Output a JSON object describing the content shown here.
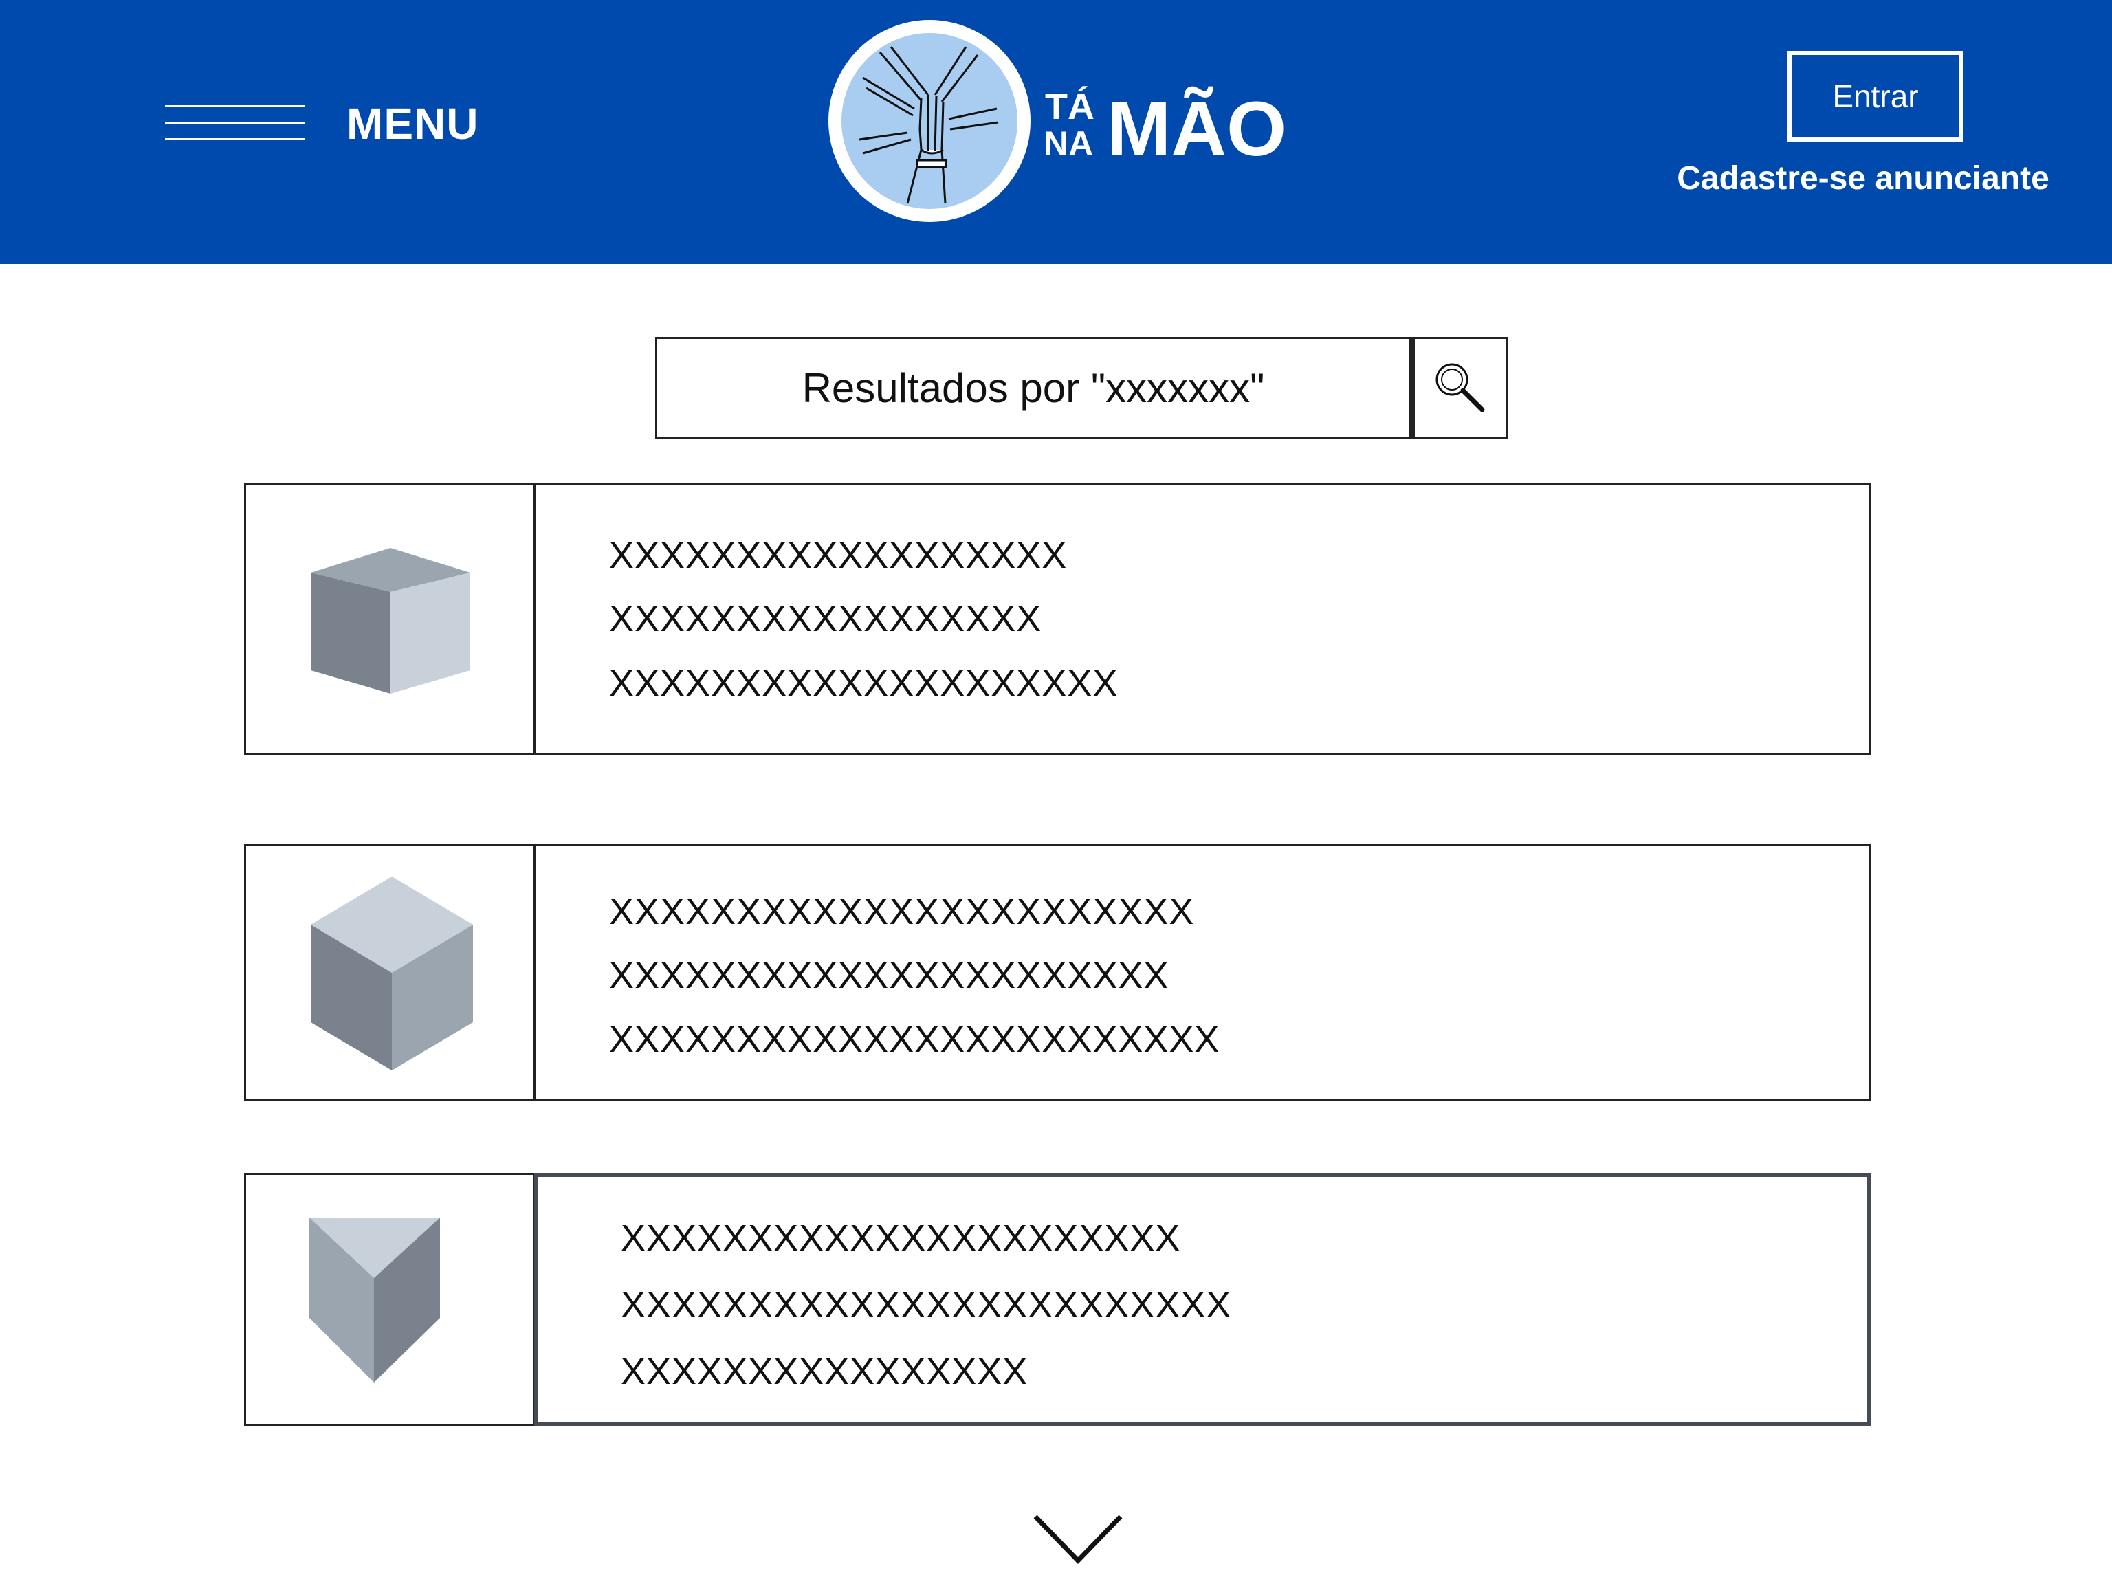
{
  "header": {
    "menu_label": "MENU",
    "logo_text": {
      "ta": "TÁ",
      "na": "NA",
      "mao": "MÃO"
    },
    "login_label": "Entrar",
    "register_label": "Cadastre-se anunciante"
  },
  "search": {
    "text": "Resultados por \"xxxxxxx\"",
    "icon": "magnifier-icon"
  },
  "results": [
    {
      "icon": "cube-icon",
      "lines": [
        "XXXXXXXXXXXXXXXXXX",
        "XXXXXXXXXXXXXXXXX",
        "XXXXXXXXXXXXXXXXXXXX"
      ]
    },
    {
      "icon": "cube-icon",
      "lines": [
        "XXXXXXXXXXXXXXXXXXXXXXX",
        "XXXXXXXXXXXXXXXXXXXXXX",
        "XXXXXXXXXXXXXXXXXXXXXXXX"
      ]
    },
    {
      "icon": "shield-cube-icon",
      "lines": [
        "XXXXXXXXXXXXXXXXXXXXXX",
        "XXXXXXXXXXXXXXXXXXXXXXXX",
        "XXXXXXXXXXXXXXXX"
      ]
    }
  ],
  "footer": {
    "icon": "chevron-down-icon"
  },
  "colors": {
    "brand_blue": "#004aad",
    "logo_light_blue": "#a9cdf0",
    "cube_dark": "#7a838d",
    "cube_mid": "#9ba5b0",
    "cube_light": "#c8d0d9"
  }
}
